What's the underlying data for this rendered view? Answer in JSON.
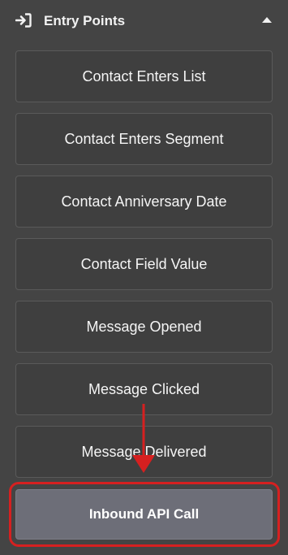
{
  "header": {
    "title": "Entry Points",
    "icon": "entry-arrow-icon",
    "collapse_icon": "caret-up-icon"
  },
  "entry_points": [
    {
      "label": "Contact Enters List"
    },
    {
      "label": "Contact Enters Segment"
    },
    {
      "label": "Contact Anniversary Date"
    },
    {
      "label": "Contact Field Value"
    },
    {
      "label": "Message Opened"
    },
    {
      "label": "Message Clicked"
    },
    {
      "label": "Message Delivered"
    }
  ],
  "selected_entry_point": {
    "label": "Inbound API Call"
  },
  "colors": {
    "background": "#444444",
    "button": "#3f3f3f",
    "selected_button": "#6d6e78",
    "annotation": "#d62020"
  }
}
